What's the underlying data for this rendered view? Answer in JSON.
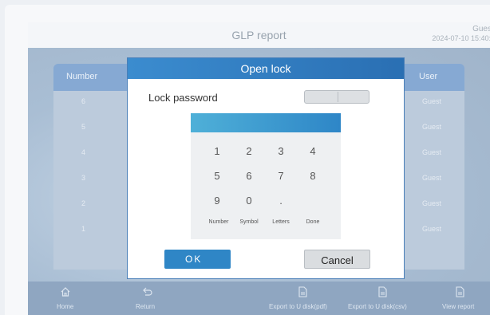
{
  "header": {
    "title": "GLP report",
    "user": "Gues",
    "datetime": "2024-07-10 15:40:2"
  },
  "table": {
    "columns": {
      "number": "Number",
      "user": "User"
    },
    "rows": [
      {
        "number": "6",
        "user": "Guest"
      },
      {
        "number": "5",
        "user": "Guest"
      },
      {
        "number": "4",
        "user": "Guest"
      },
      {
        "number": "3",
        "user": "Guest"
      },
      {
        "number": "2",
        "user": "Guest"
      },
      {
        "number": "1",
        "user": "Guest"
      }
    ]
  },
  "bottom_bar": {
    "home": {
      "label": "Home",
      "icon": "home-icon"
    },
    "return": {
      "label": "Return",
      "icon": "return-icon"
    },
    "export_pdf": {
      "label": "Export to U disk(pdf)",
      "icon": "document-icon"
    },
    "export_csv": {
      "label": "Export to U disk(csv)",
      "icon": "document-icon"
    },
    "view_report": {
      "label": "View report",
      "icon": "document-icon"
    }
  },
  "dialog": {
    "title": "Open lock",
    "password_label": "Lock password",
    "password_value": "",
    "keypad": {
      "keys": [
        "1",
        "2",
        "3",
        "4",
        "5",
        "6",
        "7",
        "8",
        "9",
        "0",
        "."
      ],
      "functions": [
        "Number",
        "Symbol",
        "Letters",
        "Done"
      ]
    },
    "ok_label": "OK",
    "cancel_label": "Cancel"
  },
  "colors": {
    "dialog_title_bar": "#2a6fb3",
    "ok_button": "#2f86c6",
    "cancel_button": "#dadde0",
    "table_header": "#86a9d3"
  }
}
